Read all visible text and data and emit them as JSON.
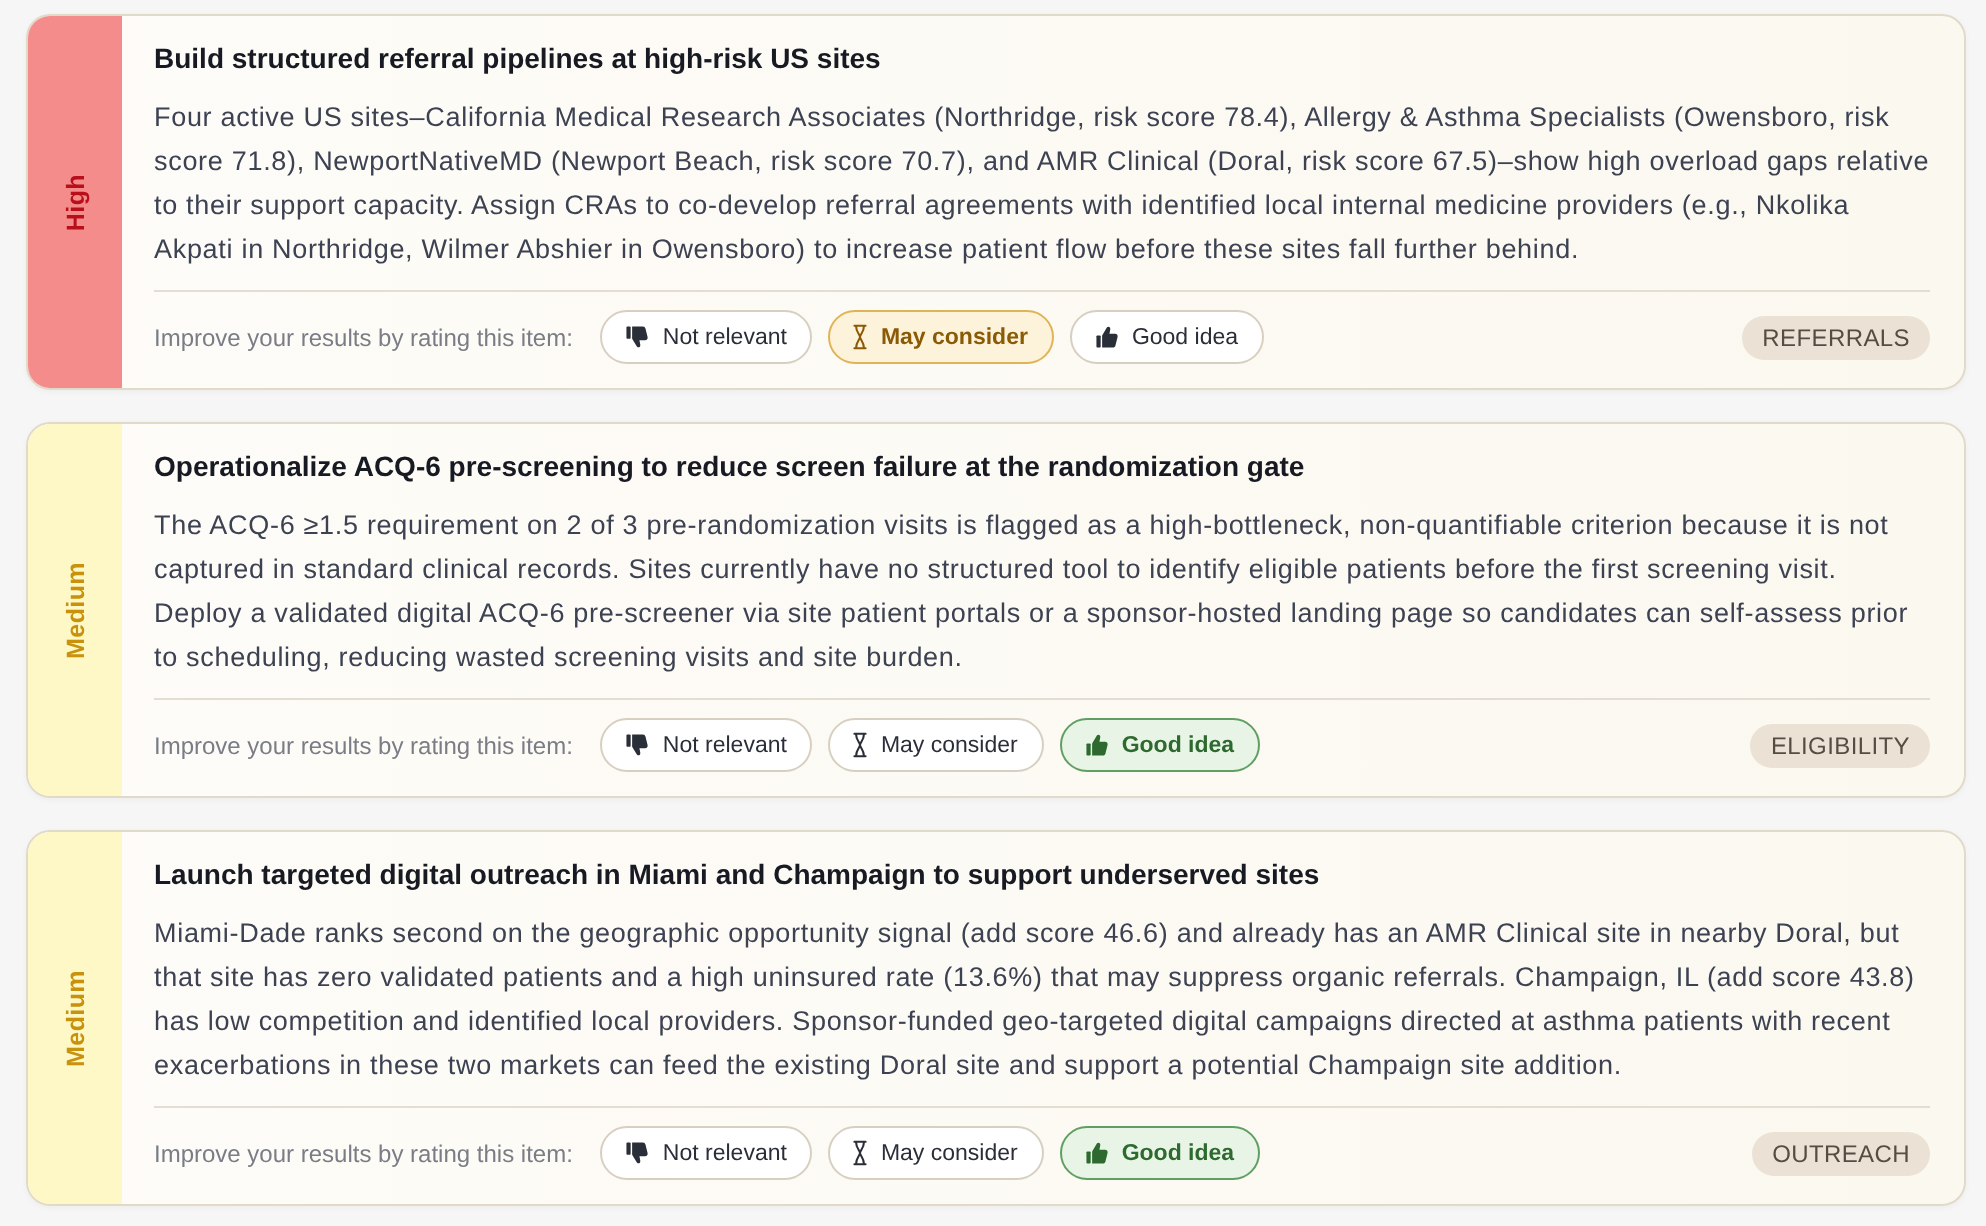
{
  "recommendations": [
    {
      "priority": {
        "label": "High",
        "kind": "high"
      },
      "title": "Build structured referral pipelines at high-risk US sites",
      "description": "Four active US sites–California Medical Research Associates (Northridge, risk score 78.4), Allergy & Asthma Specialists (Owensboro, risk score 71.8), NewportNativeMD (Newport Beach, risk score 70.7), and AMR Clinical (Doral, risk score 67.5)–show high overload gaps relative to their support capacity. Assign CRAs to co-develop referral agreements with identified local internal medicine providers (e.g., Nkolika Akpati in Northridge, Wilmer Abshier in Owensboro) to increase patient flow before these sites fall further behind.",
      "rating_prompt": "Improve your results by rating this item:",
      "ratings": [
        {
          "kind": "not_relevant",
          "label": "Not relevant",
          "selected": false
        },
        {
          "kind": "may_consider",
          "label": "May consider",
          "selected": true
        },
        {
          "kind": "good_idea",
          "label": "Good idea",
          "selected": false
        }
      ],
      "tag": "REFERRALS"
    },
    {
      "priority": {
        "label": "Medium",
        "kind": "medium"
      },
      "title": "Operationalize ACQ-6 pre-screening to reduce screen failure at the randomization gate",
      "description": "The ACQ-6 ≥1.5 requirement on 2 of 3 pre-randomization visits is flagged as a high-bottleneck, non-quantifiable criterion because it is not captured in standard clinical records. Sites currently have no structured tool to identify eligible patients before the first screening visit. Deploy a validated digital ACQ-6 pre-screener via site patient portals or a sponsor-hosted landing page so candidates can self-assess prior to scheduling, reducing wasted screening visits and site burden.",
      "rating_prompt": "Improve your results by rating this item:",
      "ratings": [
        {
          "kind": "not_relevant",
          "label": "Not relevant",
          "selected": false
        },
        {
          "kind": "may_consider",
          "label": "May consider",
          "selected": false
        },
        {
          "kind": "good_idea",
          "label": "Good idea",
          "selected": true
        }
      ],
      "tag": "ELIGIBILITY"
    },
    {
      "priority": {
        "label": "Medium",
        "kind": "medium"
      },
      "title": "Launch targeted digital outreach in Miami and Champaign to support underserved sites",
      "description": "Miami-Dade ranks second on the geographic opportunity signal (add score 46.6) and already has an AMR Clinical site in nearby Doral, but that site has zero validated patients and a high uninsured rate (13.6%) that may suppress organic referrals. Champaign, IL (add score 43.8) has low competition and identified local providers. Sponsor-funded geo-targeted digital campaigns directed at asthma patients with recent exacerbations in these two markets can feed the existing Doral site and support a potential Champaign site addition.",
      "rating_prompt": "Improve your results by rating this item:",
      "ratings": [
        {
          "kind": "not_relevant",
          "label": "Not relevant",
          "selected": false
        },
        {
          "kind": "may_consider",
          "label": "May consider",
          "selected": false
        },
        {
          "kind": "good_idea",
          "label": "Good idea",
          "selected": true
        }
      ],
      "tag": "OUTREACH"
    }
  ]
}
